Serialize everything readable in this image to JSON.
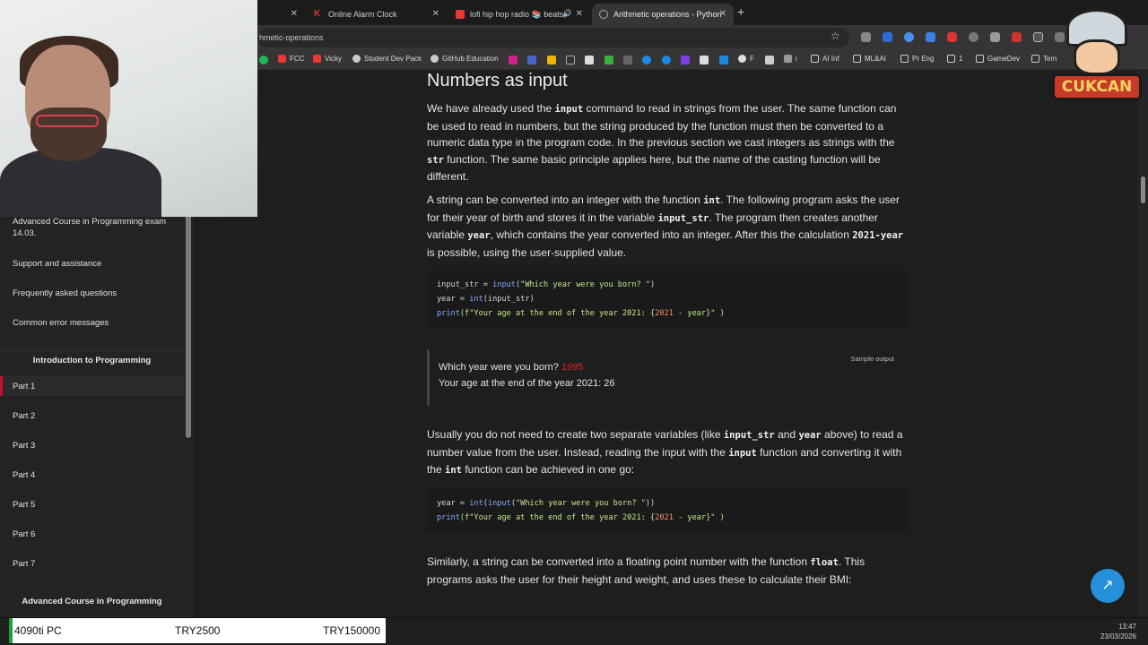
{
  "tabs": [
    {
      "label": "",
      "active": false
    },
    {
      "label": "Online Alarm Clock",
      "active": false
    },
    {
      "label": "lofi hip hop radio 📚 beats",
      "active": false
    },
    {
      "label": "Arithmetic operations - Python",
      "active": true
    }
  ],
  "address": {
    "url": "hmetic-operations"
  },
  "bookmarks": [
    "FCC",
    "Vicky",
    "Student Dev Pack",
    "GitHub Education",
    "F",
    "i",
    "AI Inf",
    "ML&AI",
    "Pr Eng",
    "1",
    "GameDev",
    "Tem"
  ],
  "sidebar": {
    "items_top": [
      "Advanced Course in Programming exam 14.03.",
      "Support and assistance",
      "Frequently asked questions",
      "Common error messages"
    ],
    "section_intro": "Introduction to Programming",
    "parts": [
      "Part 1",
      "Part 2",
      "Part 3",
      "Part 4",
      "Part 5",
      "Part 6",
      "Part 7"
    ],
    "section_advanced": "Advanced Course in Programming"
  },
  "main": {
    "heading": "Numbers as input",
    "p1": {
      "a": "We have already used the ",
      "c1": "input",
      "b": " command to read in strings from the user. The same function can be used to read in numbers, but the string produced by the function must then be converted to a numeric data type in the program code. In the previous section we cast integers as strings with the ",
      "c2": "str",
      "c": " function. The same basic principle applies here, but the name of the casting function will be different."
    },
    "p2": {
      "a": "A string can be converted into an integer with the function ",
      "c1": "int",
      "b": ". The following program asks the user for their year of birth and stores it in the variable ",
      "c2": "input_str",
      "c": ". The program then creates another variable ",
      "c3": "year",
      "d": ", which contains the year converted into an integer. After this the calculation ",
      "c4": "2021-year",
      "e": " is possible, using the user-supplied value."
    },
    "code1": {
      "l1a": "input_str = ",
      "l1b": "input",
      "l1c": "(",
      "l1d": "\"Which year were you born? \"",
      "l1e": ")",
      "l2a": "year = ",
      "l2b": "int",
      "l2c": "(input_str)",
      "l3a": "print",
      "l3b": "(f\"Your age at the end of the year 2021: {",
      "l3c": "2021",
      "l3d": " - year}\" )"
    },
    "sample": {
      "label": "Sample output",
      "q": "Which year were you born? ",
      "input": "1995",
      "answer": "Your age at the end of the year 2021: 26"
    },
    "p3": {
      "a": "Usually you do not need to create two separate variables (like ",
      "c1": "input_str",
      "b": " and ",
      "c2": "year",
      "c": " above) to read a number value from the user. Instead, reading the input with the ",
      "c3": "input",
      "d": " function and converting it with the ",
      "c4": "int",
      "e": " function can be achieved in one go:"
    },
    "code2": {
      "l1a": "year = ",
      "l1b": "int",
      "l1c": "(",
      "l1d": "input",
      "l1e": "(",
      "l1f": "\"Which year were you born? \"",
      "l1g": "))",
      "l2a": "print",
      "l2b": "(f\"Your age at the end of the year 2021: {",
      "l2c": "2021",
      "l2d": " - year}\" )"
    },
    "p4": {
      "a": "Similarly, a string can be converted into a floating point number with the function ",
      "c1": "float",
      "b": ". This programs asks the user for their height and weight, and uses these to calculate their BMI:"
    }
  },
  "overlay": {
    "logo_text": "CUKCAN"
  },
  "taskbar": {
    "ticker_name": "4090ti PC",
    "ticker_price": "TRY2500",
    "ticker_goal": "TRY150000",
    "time": "13:47",
    "date": "23/03/2026"
  },
  "colors": {
    "accent": "#c8102e",
    "fab": "#2590d8",
    "ticker_bar": "#19a33a"
  }
}
